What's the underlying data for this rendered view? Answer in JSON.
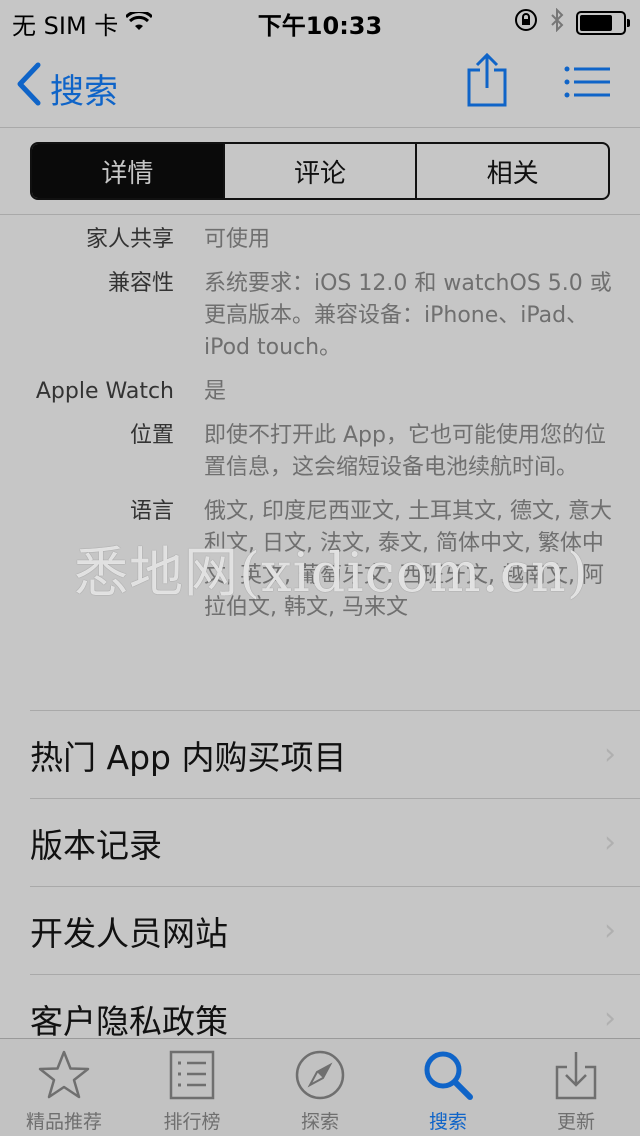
{
  "status": {
    "carrier": "无 SIM 卡",
    "time": "下午10:33",
    "battery_level": 0.75
  },
  "nav": {
    "back_label": "搜索",
    "icons": [
      "chevron-left-icon",
      "share-icon",
      "list-icon"
    ]
  },
  "segment": {
    "items": [
      "详情",
      "评论",
      "相关"
    ],
    "selected": "详情"
  },
  "info": [
    {
      "key": "家人共享",
      "value": "可使用"
    },
    {
      "key": "兼容性",
      "value": "系统要求：iOS 12.0 和 watchOS 5.0 或更高版本。兼容设备：iPhone、iPad、iPod touch。"
    },
    {
      "key": "Apple Watch",
      "value": "是"
    },
    {
      "key": "位置",
      "value": "即使不打开此 App，它也可能使用您的位置信息，这会缩短设备电池续航时间。"
    },
    {
      "key": "语言",
      "value": "俄文, 印度尼西亚文, 土耳其文, 德文, 意大利文, 日文, 法文, 泰文, 简体中文, 繁体中文, 英文, 葡萄牙文, 西班牙文, 越南文, 阿拉伯文, 韩文, 马来文"
    }
  ],
  "list": [
    {
      "label": "热门 App 内购买项目"
    },
    {
      "label": "版本记录"
    },
    {
      "label": "开发人员网站"
    },
    {
      "label": "客户隐私政策"
    }
  ],
  "watermark": "悉地网(xidicom.cn)",
  "tabbar": [
    {
      "label": "精品推荐",
      "icon": "star-icon"
    },
    {
      "label": "排行榜",
      "icon": "ranking-list-icon"
    },
    {
      "label": "探索",
      "icon": "compass-icon"
    },
    {
      "label": "搜索",
      "icon": "search-icon",
      "active": true
    },
    {
      "label": "更新",
      "icon": "download-icon"
    }
  ],
  "colors": {
    "accent": "#0f64c8",
    "background": "#c6c6c6"
  }
}
